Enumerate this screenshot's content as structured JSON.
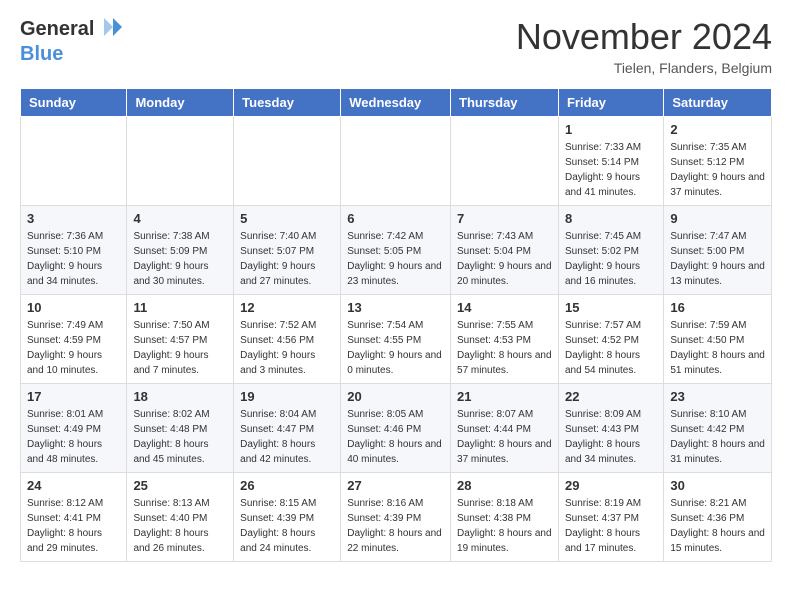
{
  "logo": {
    "line1": "General",
    "line2": "Blue"
  },
  "title": "November 2024",
  "location": "Tielen, Flanders, Belgium",
  "days_of_week": [
    "Sunday",
    "Monday",
    "Tuesday",
    "Wednesday",
    "Thursday",
    "Friday",
    "Saturday"
  ],
  "weeks": [
    [
      {
        "day": "",
        "sunrise": "",
        "sunset": "",
        "daylight": ""
      },
      {
        "day": "",
        "sunrise": "",
        "sunset": "",
        "daylight": ""
      },
      {
        "day": "",
        "sunrise": "",
        "sunset": "",
        "daylight": ""
      },
      {
        "day": "",
        "sunrise": "",
        "sunset": "",
        "daylight": ""
      },
      {
        "day": "",
        "sunrise": "",
        "sunset": "",
        "daylight": ""
      },
      {
        "day": "1",
        "sunrise": "Sunrise: 7:33 AM",
        "sunset": "Sunset: 5:14 PM",
        "daylight": "Daylight: 9 hours and 41 minutes."
      },
      {
        "day": "2",
        "sunrise": "Sunrise: 7:35 AM",
        "sunset": "Sunset: 5:12 PM",
        "daylight": "Daylight: 9 hours and 37 minutes."
      }
    ],
    [
      {
        "day": "3",
        "sunrise": "Sunrise: 7:36 AM",
        "sunset": "Sunset: 5:10 PM",
        "daylight": "Daylight: 9 hours and 34 minutes."
      },
      {
        "day": "4",
        "sunrise": "Sunrise: 7:38 AM",
        "sunset": "Sunset: 5:09 PM",
        "daylight": "Daylight: 9 hours and 30 minutes."
      },
      {
        "day": "5",
        "sunrise": "Sunrise: 7:40 AM",
        "sunset": "Sunset: 5:07 PM",
        "daylight": "Daylight: 9 hours and 27 minutes."
      },
      {
        "day": "6",
        "sunrise": "Sunrise: 7:42 AM",
        "sunset": "Sunset: 5:05 PM",
        "daylight": "Daylight: 9 hours and 23 minutes."
      },
      {
        "day": "7",
        "sunrise": "Sunrise: 7:43 AM",
        "sunset": "Sunset: 5:04 PM",
        "daylight": "Daylight: 9 hours and 20 minutes."
      },
      {
        "day": "8",
        "sunrise": "Sunrise: 7:45 AM",
        "sunset": "Sunset: 5:02 PM",
        "daylight": "Daylight: 9 hours and 16 minutes."
      },
      {
        "day": "9",
        "sunrise": "Sunrise: 7:47 AM",
        "sunset": "Sunset: 5:00 PM",
        "daylight": "Daylight: 9 hours and 13 minutes."
      }
    ],
    [
      {
        "day": "10",
        "sunrise": "Sunrise: 7:49 AM",
        "sunset": "Sunset: 4:59 PM",
        "daylight": "Daylight: 9 hours and 10 minutes."
      },
      {
        "day": "11",
        "sunrise": "Sunrise: 7:50 AM",
        "sunset": "Sunset: 4:57 PM",
        "daylight": "Daylight: 9 hours and 7 minutes."
      },
      {
        "day": "12",
        "sunrise": "Sunrise: 7:52 AM",
        "sunset": "Sunset: 4:56 PM",
        "daylight": "Daylight: 9 hours and 3 minutes."
      },
      {
        "day": "13",
        "sunrise": "Sunrise: 7:54 AM",
        "sunset": "Sunset: 4:55 PM",
        "daylight": "Daylight: 9 hours and 0 minutes."
      },
      {
        "day": "14",
        "sunrise": "Sunrise: 7:55 AM",
        "sunset": "Sunset: 4:53 PM",
        "daylight": "Daylight: 8 hours and 57 minutes."
      },
      {
        "day": "15",
        "sunrise": "Sunrise: 7:57 AM",
        "sunset": "Sunset: 4:52 PM",
        "daylight": "Daylight: 8 hours and 54 minutes."
      },
      {
        "day": "16",
        "sunrise": "Sunrise: 7:59 AM",
        "sunset": "Sunset: 4:50 PM",
        "daylight": "Daylight: 8 hours and 51 minutes."
      }
    ],
    [
      {
        "day": "17",
        "sunrise": "Sunrise: 8:01 AM",
        "sunset": "Sunset: 4:49 PM",
        "daylight": "Daylight: 8 hours and 48 minutes."
      },
      {
        "day": "18",
        "sunrise": "Sunrise: 8:02 AM",
        "sunset": "Sunset: 4:48 PM",
        "daylight": "Daylight: 8 hours and 45 minutes."
      },
      {
        "day": "19",
        "sunrise": "Sunrise: 8:04 AM",
        "sunset": "Sunset: 4:47 PM",
        "daylight": "Daylight: 8 hours and 42 minutes."
      },
      {
        "day": "20",
        "sunrise": "Sunrise: 8:05 AM",
        "sunset": "Sunset: 4:46 PM",
        "daylight": "Daylight: 8 hours and 40 minutes."
      },
      {
        "day": "21",
        "sunrise": "Sunrise: 8:07 AM",
        "sunset": "Sunset: 4:44 PM",
        "daylight": "Daylight: 8 hours and 37 minutes."
      },
      {
        "day": "22",
        "sunrise": "Sunrise: 8:09 AM",
        "sunset": "Sunset: 4:43 PM",
        "daylight": "Daylight: 8 hours and 34 minutes."
      },
      {
        "day": "23",
        "sunrise": "Sunrise: 8:10 AM",
        "sunset": "Sunset: 4:42 PM",
        "daylight": "Daylight: 8 hours and 31 minutes."
      }
    ],
    [
      {
        "day": "24",
        "sunrise": "Sunrise: 8:12 AM",
        "sunset": "Sunset: 4:41 PM",
        "daylight": "Daylight: 8 hours and 29 minutes."
      },
      {
        "day": "25",
        "sunrise": "Sunrise: 8:13 AM",
        "sunset": "Sunset: 4:40 PM",
        "daylight": "Daylight: 8 hours and 26 minutes."
      },
      {
        "day": "26",
        "sunrise": "Sunrise: 8:15 AM",
        "sunset": "Sunset: 4:39 PM",
        "daylight": "Daylight: 8 hours and 24 minutes."
      },
      {
        "day": "27",
        "sunrise": "Sunrise: 8:16 AM",
        "sunset": "Sunset: 4:39 PM",
        "daylight": "Daylight: 8 hours and 22 minutes."
      },
      {
        "day": "28",
        "sunrise": "Sunrise: 8:18 AM",
        "sunset": "Sunset: 4:38 PM",
        "daylight": "Daylight: 8 hours and 19 minutes."
      },
      {
        "day": "29",
        "sunrise": "Sunrise: 8:19 AM",
        "sunset": "Sunset: 4:37 PM",
        "daylight": "Daylight: 8 hours and 17 minutes."
      },
      {
        "day": "30",
        "sunrise": "Sunrise: 8:21 AM",
        "sunset": "Sunset: 4:36 PM",
        "daylight": "Daylight: 8 hours and 15 minutes."
      }
    ]
  ]
}
